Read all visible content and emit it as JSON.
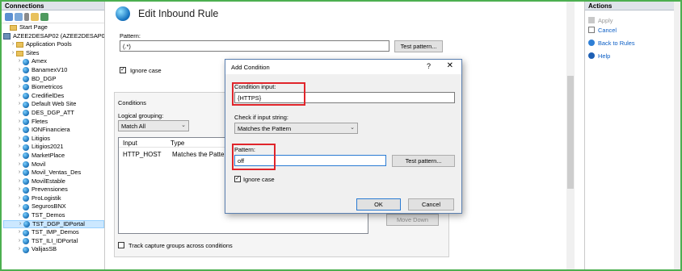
{
  "connections": {
    "title": "Connections",
    "tree": [
      {
        "label": "Start Page",
        "icon": "start-page-icon",
        "level": 0
      },
      {
        "label": "AZEE2DESAP02 (AZEE2DESAP02\\Test",
        "icon": "server-icon",
        "level": 0
      },
      {
        "label": "Application Pools",
        "icon": "app-pools-icon",
        "level": 1
      },
      {
        "label": "Sites",
        "icon": "folder-icon",
        "level": 1
      },
      {
        "label": "Amex",
        "icon": "globe-icon",
        "level": 2
      },
      {
        "label": "BanamexV10",
        "icon": "globe-icon",
        "level": 2
      },
      {
        "label": "BD_DGP",
        "icon": "globe-icon",
        "level": 2
      },
      {
        "label": "Biometricos",
        "icon": "globe-icon",
        "level": 2
      },
      {
        "label": "CredifielDes",
        "icon": "globe-icon",
        "level": 2
      },
      {
        "label": "Default Web Site",
        "icon": "globe-icon",
        "level": 2
      },
      {
        "label": "DES_DGP_ATT",
        "icon": "globe-icon",
        "level": 2
      },
      {
        "label": "Fletes",
        "icon": "globe-icon",
        "level": 2
      },
      {
        "label": "IONFinanciera",
        "icon": "globe-icon",
        "level": 2
      },
      {
        "label": "Litigios",
        "icon": "globe-icon",
        "level": 2
      },
      {
        "label": "Litigios2021",
        "icon": "globe-icon",
        "level": 2
      },
      {
        "label": "MarketPlace",
        "icon": "globe-icon",
        "level": 2
      },
      {
        "label": "Movil",
        "icon": "globe-icon",
        "level": 2
      },
      {
        "label": "Movil_Ventas_Des",
        "icon": "globe-icon",
        "level": 2
      },
      {
        "label": "MovilEstable",
        "icon": "globe-icon",
        "level": 2
      },
      {
        "label": "Prevensiones",
        "icon": "globe-icon",
        "level": 2
      },
      {
        "label": "ProLogistik",
        "icon": "globe-icon",
        "level": 2
      },
      {
        "label": "SegurosBNX",
        "icon": "globe-icon",
        "level": 2
      },
      {
        "label": "TST_Demos",
        "icon": "globe-icon",
        "level": 2
      },
      {
        "label": "TST_DGP_IDPortal",
        "icon": "globe-icon",
        "level": 2,
        "selected": true
      },
      {
        "label": "TST_IMP_Demos",
        "icon": "globe-icon",
        "level": 2
      },
      {
        "label": "TST_ILI_IDPortal",
        "icon": "globe-icon",
        "level": 2
      },
      {
        "label": "ValijasSB",
        "icon": "globe-icon",
        "level": 2
      }
    ]
  },
  "main": {
    "title": "Edit Inbound Rule",
    "pattern_label": "Pattern:",
    "pattern_value": "(.*)",
    "test_pattern_label": "Test pattern...",
    "ignore_case_label": "Ignore case",
    "conditions_label": "Conditions",
    "logical_grouping_label": "Logical grouping:",
    "logical_grouping_value": "Match All",
    "columns": [
      "Input",
      "Type"
    ],
    "rows": [
      [
        "HTTP_HOST",
        "Matches the Pattern"
      ]
    ],
    "move_down_label": "Move Down",
    "track_label": "Track capture groups across conditions"
  },
  "dialog": {
    "title": "Add Condition",
    "help_glyph": "?",
    "close_glyph": "✕",
    "condition_input_label": "Condition input:",
    "condition_input_value": "{HTTPS}",
    "check_label": "Check if input string:",
    "check_value": "Matches the Pattern",
    "pattern_label": "Pattern:",
    "pattern_value": "off",
    "test_pattern_label": "Test pattern...",
    "ignore_case_label": "Ignore case",
    "ok_label": "OK",
    "cancel_label": "Cancel"
  },
  "actions": {
    "title": "Actions",
    "items": [
      {
        "label": "Apply",
        "icon": "apply-icon",
        "enabled": false
      },
      {
        "label": "Cancel",
        "icon": "cancel-icon",
        "enabled": true
      },
      {
        "label": "Back to Rules",
        "icon": "back-arrow-icon",
        "enabled": true
      },
      {
        "label": "Help",
        "icon": "help-icon",
        "enabled": true
      }
    ]
  },
  "colors": {
    "highlight": "#e0252b",
    "frame": "#4caf50",
    "selection": "#cce8ff"
  }
}
